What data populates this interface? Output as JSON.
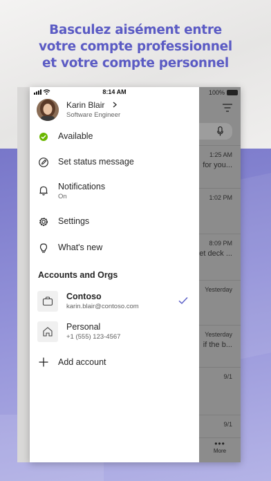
{
  "headline": {
    "line1": "Basculez aisément entre",
    "line2": "votre compte professionnel",
    "line3": "et votre compte personnel"
  },
  "status_bar": {
    "time": "8:14 AM",
    "battery": "100%"
  },
  "profile": {
    "name": "Karin Blair",
    "role": "Software Engineer"
  },
  "menu": {
    "available": "Available",
    "set_status": "Set status message",
    "notifications": "Notifications",
    "notifications_sub": "On",
    "settings": "Settings",
    "whats_new": "What's new"
  },
  "accounts": {
    "section_title": "Accounts and Orgs",
    "items": [
      {
        "name": "Contoso",
        "sub": "karin.blair@contoso.com",
        "selected": true
      },
      {
        "name": "Personal",
        "sub": "+1 (555) 123-4567",
        "selected": false
      }
    ],
    "add_label": "Add account"
  },
  "background_chats": [
    {
      "time": "1:25 AM",
      "snippet": "for you..."
    },
    {
      "time": "1:02 PM",
      "snippet": ""
    },
    {
      "time": "8:09 PM",
      "snippet": "et deck ..."
    },
    {
      "time": "Yesterday",
      "snippet": ""
    },
    {
      "time": "Yesterday",
      "snippet": "if the b..."
    },
    {
      "time": "9/1",
      "snippet": ""
    },
    {
      "time": "9/1",
      "snippet": ""
    }
  ],
  "bottom_nav": {
    "more_label": "More"
  },
  "colors": {
    "brand": "#5b5bc4",
    "available": "#6bb700",
    "check": "#5b5fc7"
  }
}
